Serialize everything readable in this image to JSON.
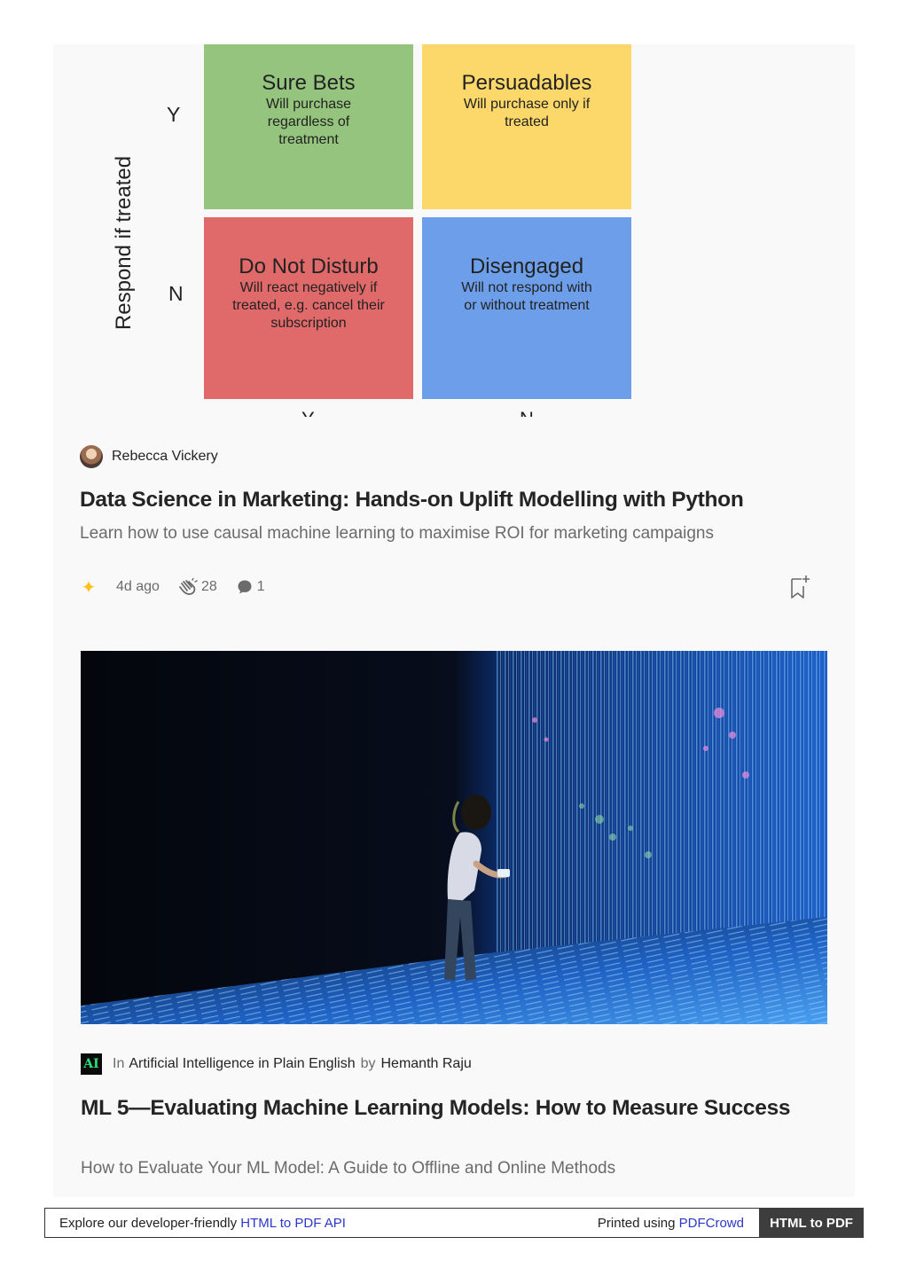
{
  "diagram": {
    "axis_title": "Respond if treated",
    "row_labels": [
      "Y",
      "N"
    ],
    "column_labels": [
      "Y",
      "N"
    ],
    "quadrants": [
      {
        "title": "Sure Bets",
        "description": "Will purchase regardless of treatment",
        "color": "#95c47e"
      },
      {
        "title": "Persuadables",
        "description": "Will purchase only if treated",
        "color": "#fcd76a"
      },
      {
        "title": "Do Not Disturb",
        "description": "Will react negatively if treated, e.g. cancel their subscription",
        "color": "#e0696a"
      },
      {
        "title": "Disengaged",
        "description": "Will not respond with or without treatment",
        "color": "#6d9ee9"
      }
    ]
  },
  "article1": {
    "author": "Rebecca Vickery",
    "title": "Data Science in Marketing: Hands-on Uplift Modelling with Python",
    "subtitle": "Learn how to use causal machine learning to maximise ROI for marketing campaigns",
    "age": "4d ago",
    "claps": "28",
    "comments": "1",
    "member_star_icon": "star-icon",
    "accent_color": "#ffc017"
  },
  "article2": {
    "publication_logo_text": "AI",
    "in_label": "In",
    "publication": "Artificial Intelligence in Plain English",
    "by_label": "by",
    "author": "Hemanth Raju",
    "title": "ML 5—Evaluating Machine Learning Models: How to Measure Success",
    "subtitle": "How to Evaluate Your ML Model: A Guide to Offline and Online Methods"
  },
  "footer": {
    "left_text": "Explore our developer-friendly",
    "left_link": "HTML to PDF API",
    "right_text": "Printed using",
    "right_link": "PDFCrowd",
    "button": "HTML to PDF"
  }
}
